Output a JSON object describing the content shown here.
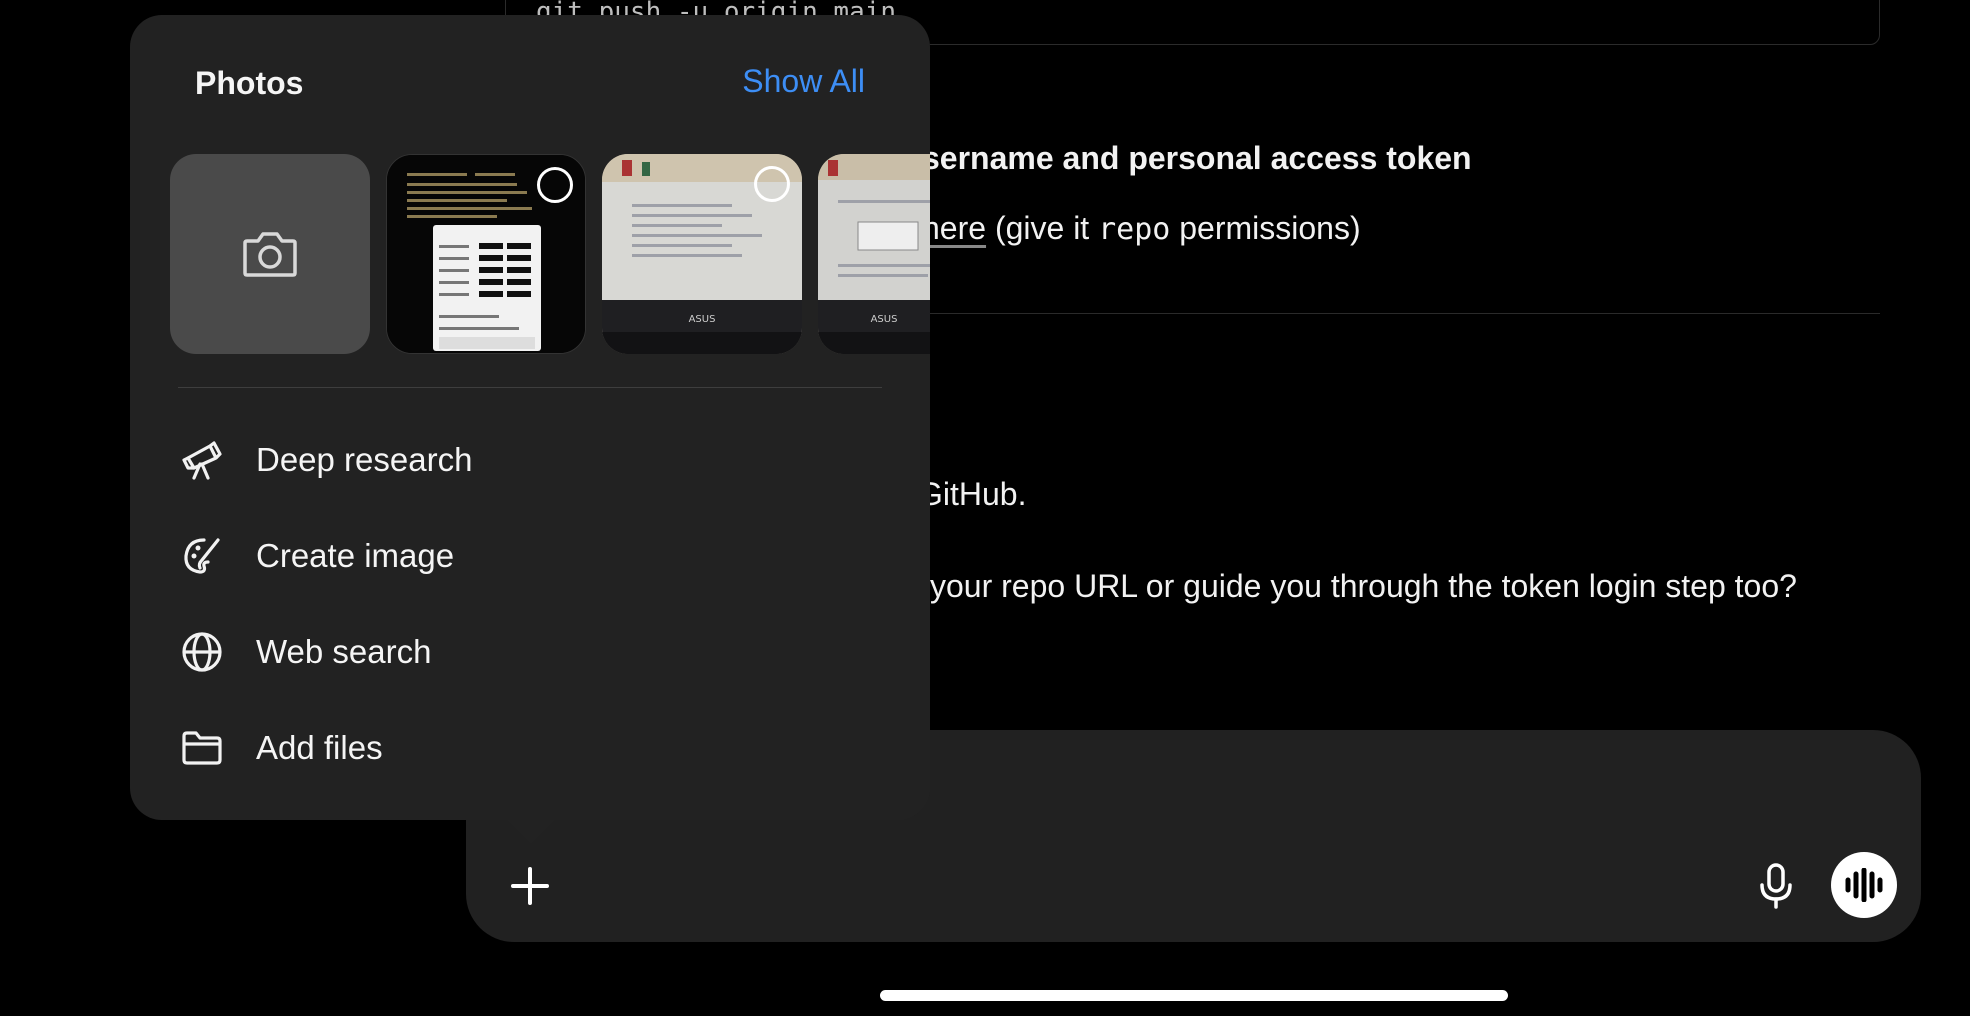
{
  "background": {
    "code_line": "git push -u origin main",
    "auth_heading": "sername and personal access token",
    "token_link": "here",
    "token_text_1": " (give it ",
    "token_code": "repo",
    "token_text_2": " permissions)",
    "github_text": "GitHub.",
    "offer_text": "your repo URL or guide you through the token login step too?"
  },
  "popover": {
    "title": "Photos",
    "show_all": "Show All",
    "thumbnails": [
      {
        "icon": "camera-icon"
      },
      {
        "kind": "phone-screenshot",
        "selected": false
      },
      {
        "kind": "laptop-photo",
        "selected": false
      },
      {
        "kind": "laptop-photo",
        "selected": false
      }
    ],
    "menu": [
      {
        "label": "Deep research",
        "icon": "telescope-icon"
      },
      {
        "label": "Create image",
        "icon": "palette-icon"
      },
      {
        "label": "Web search",
        "icon": "globe-icon"
      },
      {
        "label": "Add files",
        "icon": "folder-icon"
      }
    ]
  },
  "composer": {
    "plus_icon": "plus-icon",
    "mic_icon": "microphone-icon",
    "voice_icon": "voice-mode-icon"
  },
  "colors": {
    "accent": "#3d8ef5",
    "popover_bg": "#222222",
    "composer_bg": "#212121",
    "background": "#000000"
  }
}
